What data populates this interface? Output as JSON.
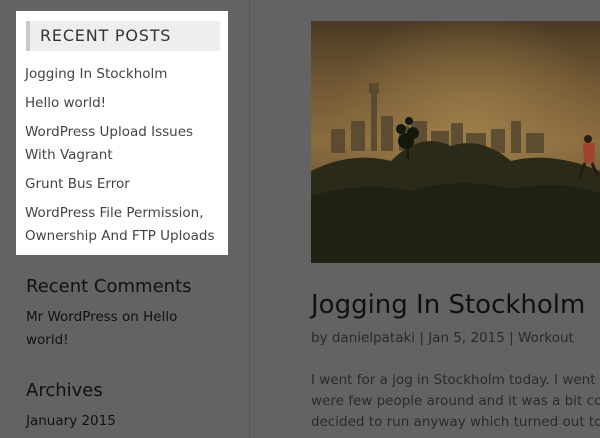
{
  "sidebar": {
    "recent_posts": {
      "heading": "RECENT POSTS",
      "items": [
        {
          "label": "Jogging In Stockholm"
        },
        {
          "label": "Hello world!"
        },
        {
          "label": "WordPress Upload Issues With Vagrant"
        },
        {
          "label": "Grunt Bus Error"
        },
        {
          "label": "WordPress File Permission, Ownership And FTP Uploads"
        }
      ]
    },
    "recent_comments": {
      "heading": "Recent Comments",
      "author": "Mr WordPress",
      "on": "on",
      "post": "Hello world!"
    },
    "archives": {
      "heading": "Archives",
      "items": [
        {
          "label": "January 2015"
        }
      ]
    }
  },
  "post": {
    "title": "Jogging In Stockholm",
    "meta": {
      "by": "by",
      "author": "danielpataki",
      "sep": "|",
      "date": "Jan 5, 2015",
      "category": "Workout"
    },
    "excerpt_lines": [
      "I went for a jog in Stockholm today. I went there",
      "were few people around and it was a bit cold",
      "decided to run anyway which turned out to be"
    ]
  },
  "colors": {
    "overlay": "#636363",
    "highlight_box": "#ffffff"
  }
}
